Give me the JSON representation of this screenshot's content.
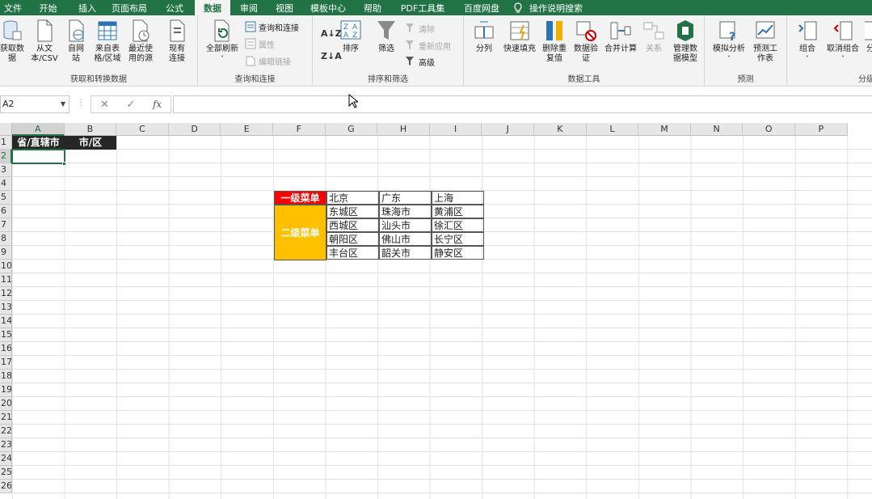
{
  "tabs": [
    "文件",
    "开始",
    "插入",
    "页面布局",
    "公式",
    "数据",
    "审阅",
    "视图",
    "模板中心",
    "帮助",
    "PDF工具集",
    "百度网盘",
    "操作说明搜索"
  ],
  "active_tab": "数据",
  "ribbon": {
    "groups": {
      "get_transform": "获取和转换数据",
      "queries": "查询和连接",
      "sort_filter": "排序和筛选",
      "data_tools": "数据工具",
      "forecast": "预测",
      "outline": "分级"
    },
    "buttons": {
      "get_data": "获取数据",
      "from_text_csv": "从文本/CSV",
      "from_web": "自网站",
      "from_table": "来自表格/区域",
      "recent_sources": "最近使用的源",
      "existing_conn": "现有连接",
      "refresh_all": "全部刷新",
      "queries_conn": "查询和连接",
      "properties": "属性",
      "edit_links": "编辑链接",
      "sort_az": "A↓Z",
      "sort": "排序",
      "filter": "筛选",
      "clear": "清除",
      "reapply": "重新应用",
      "advanced": "高级",
      "split": "分列",
      "flash_fill": "快速填充",
      "remove_dup": "删除重复值",
      "validation": "数据验证",
      "consolidate": "合并计算",
      "relations": "关系",
      "manage_model": "管理数据模型",
      "whatif": "模拟分析",
      "forecast_sheet": "预测工作表",
      "group": "组合",
      "ungroup": "取消组合",
      "subtotal": "分"
    }
  },
  "formula_bar": {
    "name_box": "A2",
    "fx": "fx",
    "value": ""
  },
  "columns": [
    "A",
    "B",
    "C",
    "D",
    "E",
    "F",
    "G",
    "H",
    "I",
    "J",
    "K",
    "L",
    "M",
    "N",
    "O",
    "P"
  ],
  "rows": [
    "1",
    "2",
    "3",
    "4",
    "5",
    "6",
    "7",
    "8",
    "9",
    "10",
    "11",
    "12",
    "13",
    "14",
    "15",
    "16",
    "17",
    "18",
    "19",
    "20",
    "21",
    "22",
    "23",
    "24",
    "25",
    "26"
  ],
  "sheet": {
    "a1": "省/直辖市",
    "b1": "市/区",
    "menu_level1": "一级菜单",
    "menu_level2": "二级菜单",
    "provinces": [
      "北京",
      "广东",
      "上海"
    ],
    "districts": [
      [
        "东城区",
        "珠海市",
        "黄浦区"
      ],
      [
        "西城区",
        "汕头市",
        "徐汇区"
      ],
      [
        "朝阳区",
        "佛山市",
        "长宁区"
      ],
      [
        "丰台区",
        "韶关市",
        "静安区"
      ]
    ]
  },
  "colors": {
    "excel_green": "#217346",
    "red": "#ff0000",
    "amber": "#ffc000",
    "dark_header": "#262626"
  }
}
